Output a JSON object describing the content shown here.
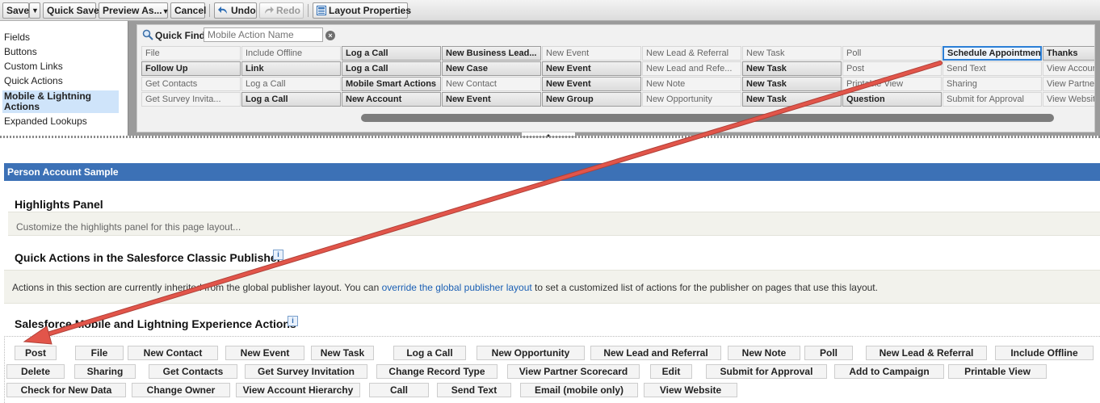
{
  "toolbar": {
    "save": "Save",
    "save_menu_icon": "▼",
    "quick_save": "Quick Save",
    "preview_as": "Preview As...",
    "preview_menu_icon": "▼",
    "cancel": "Cancel",
    "undo": "Undo",
    "redo": "Redo",
    "layout_properties": "Layout Properties"
  },
  "categories": [
    {
      "label": "Fields"
    },
    {
      "label": "Buttons"
    },
    {
      "label": "Custom Links"
    },
    {
      "label": "Quick Actions"
    },
    {
      "label": "Mobile & Lightning Actions",
      "active": true
    },
    {
      "label": "Expanded Lookups"
    }
  ],
  "quick_find": {
    "label": "Quick Find",
    "placeholder": "Mobile Action Name",
    "clear_icon": "×"
  },
  "palette_items": [
    [
      "File",
      "Include Offline",
      "Log a Call",
      "New Business Lead...",
      "New Event",
      "New Lead & Referral",
      "New Task",
      "Poll",
      "Schedule Appointment",
      "Thanks"
    ],
    [
      "Follow Up",
      "Link",
      "Log a Call",
      "New Case",
      "New Event",
      "New Lead and Refe...",
      "New Task",
      "Post",
      "Send Text",
      "View Accoun"
    ],
    [
      "Get Contacts",
      "Log a Call",
      "Mobile Smart Actions",
      "New Contact",
      "New Event",
      "New Note",
      "New Task",
      "Printable View",
      "Sharing",
      "View Partner"
    ],
    [
      "Get Survey Invita...",
      "Log a Call",
      "New Account",
      "New Event",
      "New Group",
      "New Opportunity",
      "New Task",
      "Question",
      "Submit for Approval",
      "View Websit"
    ]
  ],
  "palette_used": [
    [
      false,
      false,
      true,
      true,
      false,
      false,
      false,
      false,
      false,
      true
    ],
    [
      true,
      true,
      true,
      true,
      true,
      false,
      true,
      false,
      false,
      false
    ],
    [
      false,
      false,
      true,
      false,
      true,
      false,
      true,
      false,
      false,
      false
    ],
    [
      false,
      true,
      true,
      true,
      true,
      false,
      true,
      true,
      false,
      false
    ]
  ],
  "highlighted_item": "Schedule Appointment",
  "layout": {
    "title": "Person Account Sample",
    "highlights_title": "Highlights Panel",
    "highlights_hint": "Customize the highlights panel for this page layout...",
    "classic_title": "Quick Actions in the Salesforce Classic Publisher",
    "classic_text_before": "Actions in this section are currently inherited from the global publisher layout. You can ",
    "classic_link": "override the global publisher layout",
    "classic_text_after": " to set a customized list of actions for the publisher on pages that use this layout.",
    "mobile_title": "Salesforce Mobile and Lightning Experience Actions",
    "info_icon": "i"
  },
  "mobile_actions": [
    [
      "Post",
      "File",
      "New Contact",
      "New Event",
      "New Task",
      "Log a Call",
      "New Opportunity",
      "New Lead and Referral",
      "New Note",
      "Poll",
      "New Lead & Referral",
      "Include Offline"
    ],
    [
      "Delete",
      "Sharing",
      "Get Contacts",
      "Get Survey Invitation",
      "Change Record Type",
      "View Partner Scorecard",
      "Edit",
      "Submit for Approval",
      "Add to Campaign",
      "Printable View"
    ],
    [
      "Check for New Data",
      "Change Owner",
      "View Account Hierarchy",
      "Call",
      "Send Text",
      "Email (mobile only)",
      "View Website"
    ]
  ],
  "colors": {
    "header_blue": "#3c71b6",
    "highlight_border": "#2b7fd6",
    "arrow_red": "#e2554a",
    "link_blue": "#1a5fb4"
  }
}
